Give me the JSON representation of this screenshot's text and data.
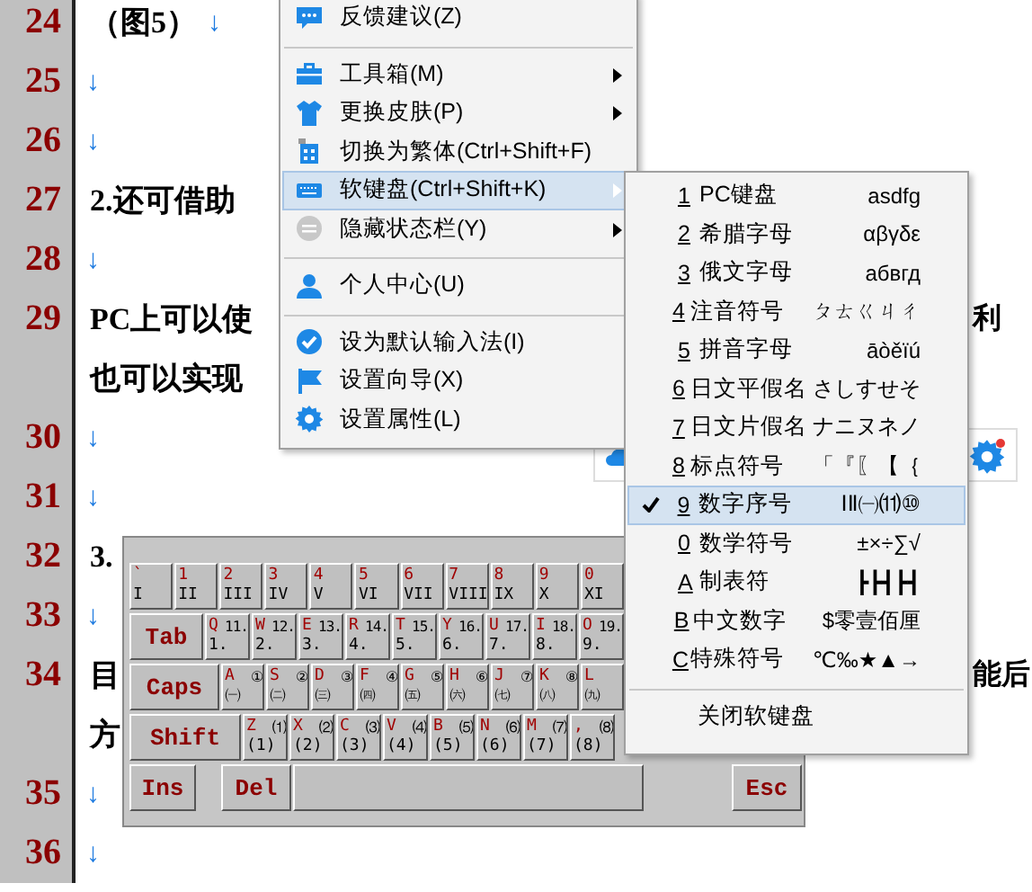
{
  "document": {
    "lines": [
      {
        "number": "24",
        "text": "（图5）",
        "mark": "↓"
      },
      {
        "number": "25",
        "mark": "↓"
      },
      {
        "number": "26",
        "mark": "↓"
      },
      {
        "number": "27",
        "text": "2.还可借助"
      },
      {
        "number": "28",
        "mark": "↓"
      },
      {
        "number": "29",
        "text": "PC上可以使",
        "right_text": "利"
      },
      {
        "text": "也可以实现"
      },
      {
        "number": "30",
        "mark": "↓"
      },
      {
        "number": "31",
        "mark": "↓"
      },
      {
        "number": "32",
        "text": "3."
      },
      {
        "number": "33",
        "mark": "↓"
      },
      {
        "number": "34",
        "text": "目",
        "right_text": "能后"
      },
      {
        "text": "方"
      },
      {
        "number": "35",
        "mark": "↓"
      },
      {
        "number": "36",
        "mark": "↓"
      }
    ]
  },
  "context_menu": {
    "items": [
      {
        "kind": "item",
        "label": "反馈建议(Z)",
        "has_submenu": false,
        "selected": false
      },
      {
        "kind": "separator"
      },
      {
        "kind": "item",
        "label": "工具箱(M)",
        "has_submenu": true,
        "selected": false
      },
      {
        "kind": "item",
        "label": "更换皮肤(P)",
        "has_submenu": true,
        "selected": false
      },
      {
        "kind": "item",
        "label": "切换为繁体(Ctrl+Shift+F)",
        "has_submenu": false,
        "selected": false
      },
      {
        "kind": "item",
        "label": "软键盘(Ctrl+Shift+K)",
        "has_submenu": true,
        "selected": true
      },
      {
        "kind": "item",
        "label": "隐藏状态栏(Y)",
        "has_submenu": true,
        "selected": false
      },
      {
        "kind": "separator"
      },
      {
        "kind": "item",
        "label": "个人中心(U)",
        "has_submenu": false,
        "selected": false
      },
      {
        "kind": "separator"
      },
      {
        "kind": "item",
        "label": "设为默认输入法(I)",
        "has_submenu": false,
        "selected": false
      },
      {
        "kind": "item",
        "label": "设置向导(X)",
        "has_submenu": false,
        "selected": false
      },
      {
        "kind": "item",
        "label": "设置属性(L)",
        "has_submenu": false,
        "selected": false
      }
    ]
  },
  "soft_keyboard_menu": {
    "items": [
      {
        "kind": "item",
        "key": "1",
        "name": "PC键盘",
        "sample": "asdfg",
        "selected": false
      },
      {
        "kind": "item",
        "key": "2",
        "name": "希腊字母",
        "sample": "αβγδε",
        "selected": false
      },
      {
        "kind": "item",
        "key": "3",
        "name": "俄文字母",
        "sample": "абвгд",
        "selected": false
      },
      {
        "kind": "item",
        "key": "4",
        "name": "注音符号",
        "sample": "ㄆㄊㄍㄐㄔ",
        "selected": false
      },
      {
        "kind": "item",
        "key": "5",
        "name": "拼音字母",
        "sample": "āòěïú",
        "selected": false
      },
      {
        "kind": "item",
        "key": "6",
        "name": "日文平假名",
        "sample": "さしすせそ",
        "selected": false
      },
      {
        "kind": "item",
        "key": "7",
        "name": "日文片假名",
        "sample": "ナニヌネノ",
        "selected": false
      },
      {
        "kind": "item",
        "key": "8",
        "name": "标点符号",
        "sample": "「『〖【｛",
        "selected": false
      },
      {
        "kind": "item",
        "key": "9",
        "name": "数字序号",
        "sample": "ⅠⅡ㈠⑾⑩",
        "selected": true
      },
      {
        "kind": "item",
        "key": "0",
        "name": "数学符号",
        "sample": "±×÷∑√",
        "selected": false
      },
      {
        "kind": "item",
        "key": "A",
        "name": "制表符",
        "sample": "┣┣┫┣┫",
        "selected": false
      },
      {
        "kind": "item",
        "key": "B",
        "name": "中文数字",
        "sample": "$零壹佰厘",
        "selected": false
      },
      {
        "kind": "item",
        "key": "C",
        "name": "特殊符号",
        "sample": "℃‰★▲→",
        "selected": false
      },
      {
        "kind": "separator"
      },
      {
        "kind": "close",
        "name": "关闭软键盘"
      }
    ]
  },
  "soft_keyboard": {
    "rows": [
      {
        "keys": [
          {
            "kind": "char",
            "upper": "`",
            "lower": "I"
          },
          {
            "kind": "char",
            "upper": "1",
            "lower": "II"
          },
          {
            "kind": "char",
            "upper": "2",
            "lower": "III"
          },
          {
            "kind": "char",
            "upper": "3",
            "lower": "IV"
          },
          {
            "kind": "char",
            "upper": "4",
            "lower": "V"
          },
          {
            "kind": "char",
            "upper": "5",
            "lower": "VI"
          },
          {
            "kind": "char",
            "upper": "6",
            "lower": "VII"
          },
          {
            "kind": "char",
            "upper": "7",
            "lower": "VIII"
          },
          {
            "kind": "char",
            "upper": "8",
            "lower": "IX"
          },
          {
            "kind": "char",
            "upper": "9",
            "lower": "X"
          },
          {
            "kind": "char",
            "upper": "0",
            "lower": "XI"
          }
        ]
      },
      {
        "keys": [
          {
            "kind": "function",
            "label": "Tab"
          },
          {
            "kind": "char",
            "upper": "Q",
            "alt": "11.",
            "lower": "1."
          },
          {
            "kind": "char",
            "upper": "W",
            "alt": "12.",
            "lower": "2."
          },
          {
            "kind": "char",
            "upper": "E",
            "alt": "13.",
            "lower": "3."
          },
          {
            "kind": "char",
            "upper": "R",
            "alt": "14.",
            "lower": "4."
          },
          {
            "kind": "char",
            "upper": "T",
            "alt": "15.",
            "lower": "5."
          },
          {
            "kind": "char",
            "upper": "Y",
            "alt": "16.",
            "lower": "6."
          },
          {
            "kind": "char",
            "upper": "U",
            "alt": "17.",
            "lower": "7."
          },
          {
            "kind": "char",
            "upper": "I",
            "alt": "18.",
            "lower": "8."
          },
          {
            "kind": "char",
            "upper": "O",
            "alt": "19.",
            "lower": "9."
          }
        ]
      },
      {
        "keys": [
          {
            "kind": "function",
            "label": "Caps"
          },
          {
            "kind": "char",
            "upper": "A",
            "alt": "①",
            "lower": "㈠"
          },
          {
            "kind": "char",
            "upper": "S",
            "alt": "②",
            "lower": "㈡"
          },
          {
            "kind": "char",
            "upper": "D",
            "alt": "③",
            "lower": "㈢"
          },
          {
            "kind": "char",
            "upper": "F",
            "alt": "④",
            "lower": "㈣"
          },
          {
            "kind": "char",
            "upper": "G",
            "alt": "⑤",
            "lower": "㈤"
          },
          {
            "kind": "char",
            "upper": "H",
            "alt": "⑥",
            "lower": "㈥"
          },
          {
            "kind": "char",
            "upper": "J",
            "alt": "⑦",
            "lower": "㈦"
          },
          {
            "kind": "char",
            "upper": "K",
            "alt": "⑧",
            "lower": "㈧"
          },
          {
            "kind": "char",
            "upper": "L",
            "lower": "㈨"
          }
        ]
      },
      {
        "keys": [
          {
            "kind": "function",
            "label": "Shift"
          },
          {
            "kind": "char",
            "upper": "Z",
            "alt": "⑴",
            "lower": "(1)"
          },
          {
            "kind": "char",
            "upper": "X",
            "alt": "⑵",
            "lower": "(2)"
          },
          {
            "kind": "char",
            "upper": "C",
            "alt": "⑶",
            "lower": "(3)"
          },
          {
            "kind": "char",
            "upper": "V",
            "alt": "⑷",
            "lower": "(4)"
          },
          {
            "kind": "char",
            "upper": "B",
            "alt": "⑸",
            "lower": "(5)"
          },
          {
            "kind": "char",
            "upper": "N",
            "alt": "⑹",
            "lower": "(6)"
          },
          {
            "kind": "char",
            "upper": "M",
            "alt": "⑺",
            "lower": "(7)"
          },
          {
            "kind": "char",
            "upper": ",",
            "alt": "⑻",
            "lower": "(8)"
          }
        ]
      },
      {
        "keys": [
          {
            "kind": "function",
            "label": "Ins"
          },
          {
            "kind": "function",
            "label": "Del"
          },
          {
            "kind": "space"
          },
          {
            "kind": "function",
            "label": "Esc"
          }
        ]
      }
    ]
  }
}
